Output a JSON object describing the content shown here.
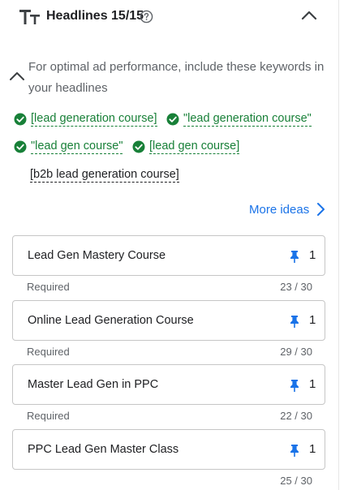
{
  "header": {
    "title": "Headlines 15/15",
    "type_icon": "text-fields-icon",
    "help_icon": "help-circle-icon",
    "collapse_icon": "chevron-up-icon"
  },
  "keyword_tip": {
    "text": "For optimal ad performance, include these keywords in your headlines",
    "chevron_icon": "chevron-up-icon"
  },
  "keywords": [
    {
      "text": "[lead generation course]",
      "included": true
    },
    {
      "text": "\"lead generation course\"",
      "included": true
    },
    {
      "text": "\"lead gen course\"",
      "included": true
    },
    {
      "text": "[lead gen course]",
      "included": true
    },
    {
      "text": "[b2b lead generation course]",
      "included": false
    }
  ],
  "more_ideas": {
    "label": "More ideas",
    "icon": "chevron-right-icon"
  },
  "headlines": [
    {
      "text": "Lead Gen Mastery Course",
      "pin_count": "1",
      "note": "Required",
      "chars": "23 / 30"
    },
    {
      "text": "Online Lead Generation Course",
      "pin_count": "1",
      "note": "Required",
      "chars": "29 / 30"
    },
    {
      "text": "Master Lead Gen in PPC",
      "pin_count": "1",
      "note": "Required",
      "chars": "22 / 30"
    },
    {
      "text": "PPC Lead Gen Master Class",
      "pin_count": "1",
      "note": "",
      "chars": "25 / 30"
    }
  ],
  "colors": {
    "accent_blue": "#1a73e8",
    "keyword_green": "#188038",
    "pin_blue": "#1a73e8",
    "muted_text": "#5f6368"
  }
}
